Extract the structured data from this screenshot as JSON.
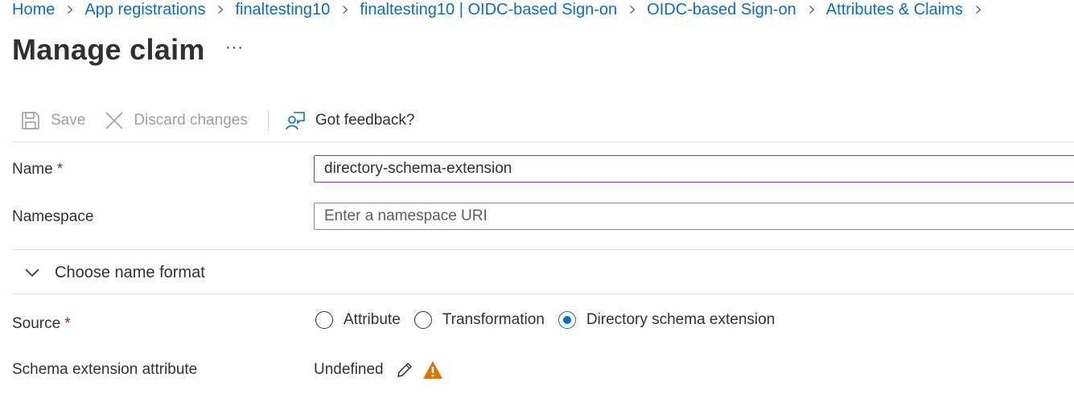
{
  "breadcrumb": {
    "items": [
      "Home",
      "App registrations",
      "finaltesting10",
      "finaltesting10 | OIDC-based Sign-on",
      "OIDC-based Sign-on",
      "Attributes & Claims"
    ]
  },
  "header": {
    "title": "Manage claim",
    "more_label": "···"
  },
  "toolbar": {
    "save_label": "Save",
    "discard_label": "Discard changes",
    "feedback_label": "Got feedback?"
  },
  "form": {
    "name_label": "Name",
    "required_mark": "*",
    "name_value": "directory-schema-extension",
    "namespace_label": "Namespace",
    "namespace_placeholder": "Enter a namespace URI",
    "name_format_toggle": "Choose name format",
    "source_label": "Source",
    "source_options": [
      "Attribute",
      "Transformation",
      "Directory schema extension"
    ],
    "source_selected": "Directory schema extension",
    "schema_attr_label": "Schema extension attribute",
    "schema_attr_value": "Undefined"
  },
  "colors": {
    "link": "#0f6cbd",
    "required": "#a4262c",
    "focus_border": "#7f3f98",
    "warning": "#d97706",
    "disabled": "#a19f9d"
  }
}
